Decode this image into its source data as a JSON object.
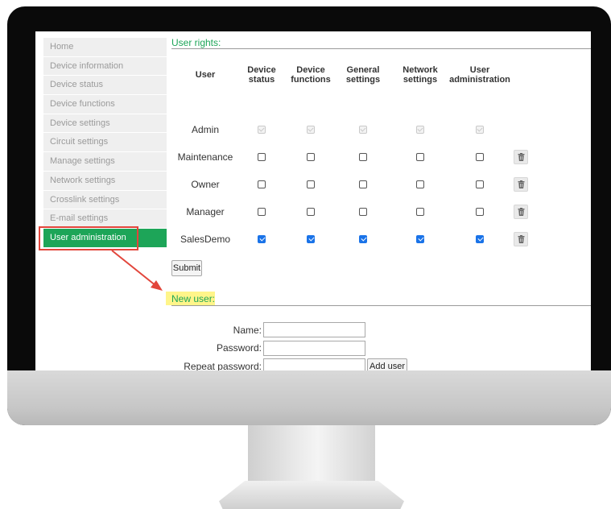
{
  "sidebar": {
    "items": [
      {
        "label": "Home"
      },
      {
        "label": "Device information"
      },
      {
        "label": "Device status"
      },
      {
        "label": "Device functions"
      },
      {
        "label": "Device settings"
      },
      {
        "label": "Circuit settings"
      },
      {
        "label": "Manage settings"
      },
      {
        "label": "Network settings"
      },
      {
        "label": "Crosslink settings"
      },
      {
        "label": "E-mail settings"
      },
      {
        "label": "User administration",
        "active": true
      }
    ]
  },
  "user_rights": {
    "title": "User rights:",
    "columns": {
      "user": "User",
      "device_status": "Device\nstatus",
      "device_functions": "Device\nfunctions",
      "general_settings": "General\nsettings",
      "network_settings": "Network\nsettings",
      "user_administration": "User\nadministration"
    },
    "rows": [
      {
        "name": "Admin",
        "rights": [
          "disabled-checked",
          "disabled-checked",
          "disabled-checked",
          "disabled-checked",
          "disabled-checked"
        ],
        "deletable": false
      },
      {
        "name": "Maintenance",
        "rights": [
          "unchecked",
          "unchecked",
          "unchecked",
          "unchecked",
          "unchecked"
        ],
        "deletable": true
      },
      {
        "name": "Owner",
        "rights": [
          "unchecked",
          "unchecked",
          "unchecked",
          "unchecked",
          "unchecked"
        ],
        "deletable": true
      },
      {
        "name": "Manager",
        "rights": [
          "unchecked",
          "unchecked",
          "unchecked",
          "unchecked",
          "unchecked"
        ],
        "deletable": true
      },
      {
        "name": "SalesDemo",
        "rights": [
          "checked",
          "checked",
          "checked",
          "checked",
          "checked"
        ],
        "deletable": true
      }
    ],
    "submit_label": "Submit"
  },
  "new_user": {
    "title": "New user:",
    "name_label": "Name:",
    "name_value": "",
    "password_label": "Password:",
    "password_value": "",
    "repeat_password_label": "Repeat password:",
    "repeat_password_value": "",
    "add_user_label": "Add user"
  },
  "colors": {
    "accent_green": "#1da558",
    "highlight_red": "#e2453b",
    "highlight_yellow": "#fff58a",
    "checkbox_blue": "#1a73e8"
  },
  "icons": {
    "delete": "trash-icon",
    "callout": "arrow-icon"
  }
}
